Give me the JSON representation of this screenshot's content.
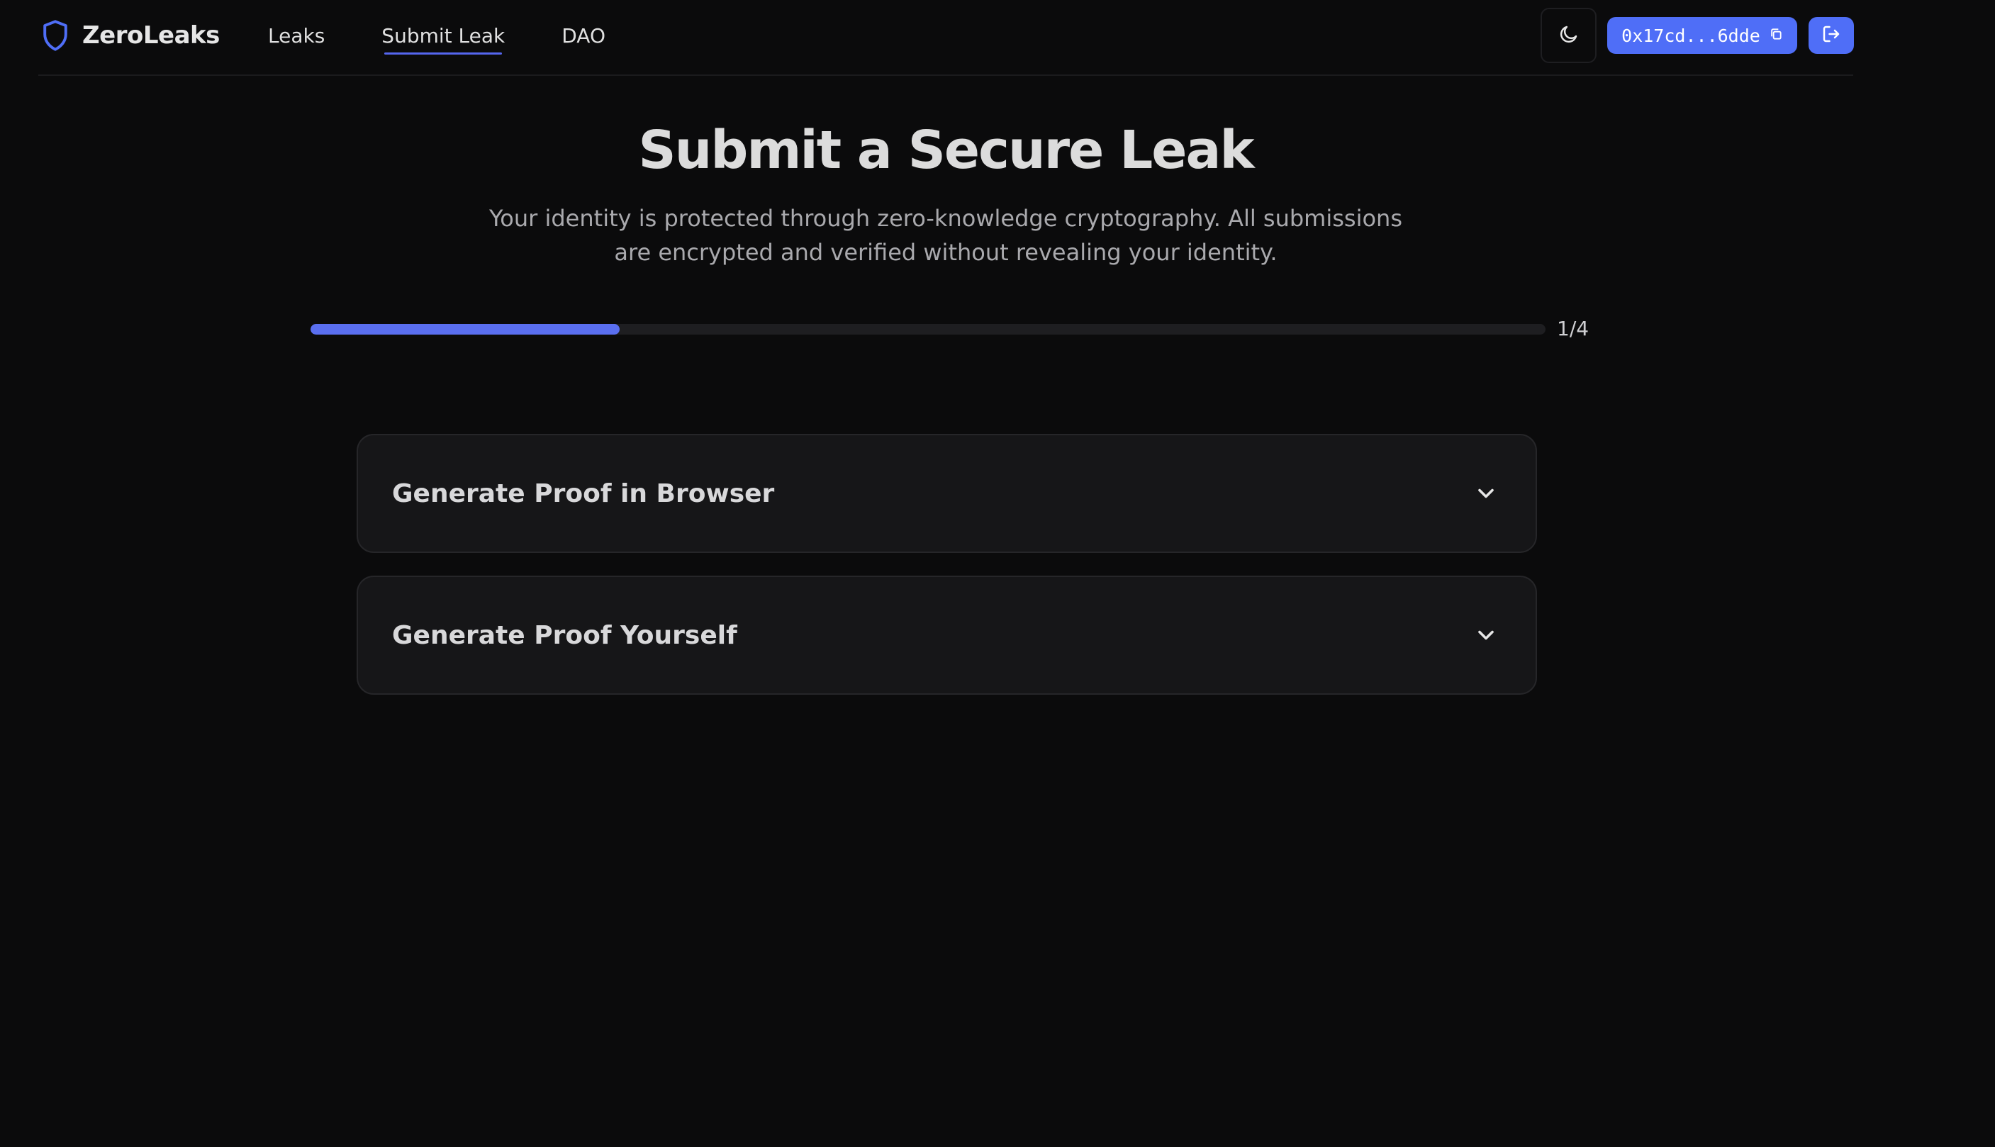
{
  "brand": {
    "name": "ZeroLeaks",
    "icon": "shield-icon",
    "accent": "#4f6ef7"
  },
  "nav": {
    "items": [
      {
        "label": "Leaks",
        "active": false
      },
      {
        "label": "Submit Leak",
        "active": true
      },
      {
        "label": "DAO",
        "active": false
      }
    ]
  },
  "header_actions": {
    "theme_icon": "moon-icon",
    "wallet_address": "0x17cd...6dde",
    "copy_icon": "copy-icon",
    "logout_icon": "logout-icon"
  },
  "main": {
    "title": "Submit a Secure Leak",
    "subtitle": "Your identity is protected through zero-knowledge cryptography. All submissions are encrypted and verified without revealing your identity.",
    "progress": {
      "current": 1,
      "total": 4,
      "label": "1/4",
      "fraction": 0.25
    },
    "sections": [
      {
        "title": "Generate Proof in Browser",
        "icon": "chevron-down-icon"
      },
      {
        "title": "Generate Proof Yourself",
        "icon": "chevron-down-icon"
      }
    ]
  },
  "colors": {
    "background": "#0b0b0c",
    "card": "#161618",
    "accent": "#4f6ef7",
    "progress_fill": "#5a6ff0"
  }
}
